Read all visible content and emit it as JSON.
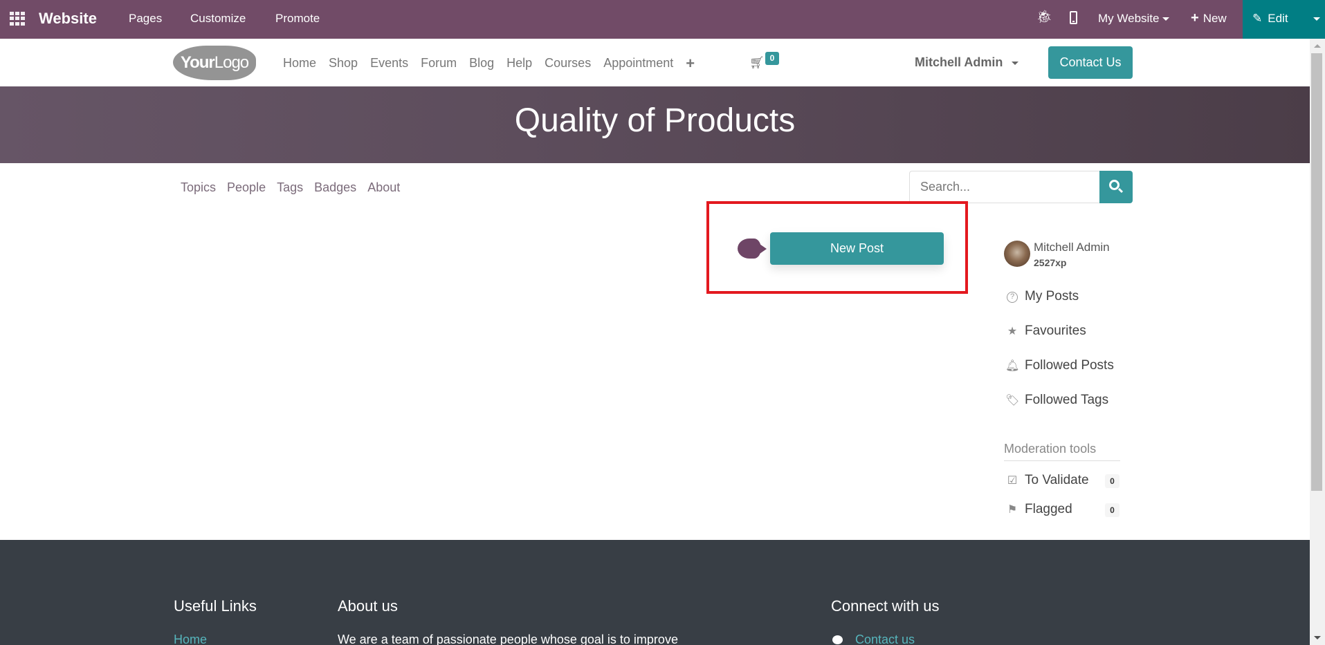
{
  "topbar": {
    "app_name": "Website",
    "menus": [
      "Pages",
      "Customize",
      "Promote"
    ],
    "website_selector": "My Website",
    "new_label": "New",
    "edit_label": "Edit",
    "icons": {
      "apps": "apps-grid-icon",
      "debug": "bug-icon",
      "mobile": "mobile-phone-icon",
      "new": "plus-icon",
      "edit": "pencil-icon"
    }
  },
  "header": {
    "logo": {
      "bold": "Your",
      "light": "Logo"
    },
    "nav": [
      "Home",
      "Shop",
      "Events",
      "Forum",
      "Blog",
      "Help",
      "Courses",
      "Appointment"
    ],
    "cart_count": "0",
    "user": "Mitchell Admin",
    "contact_label": "Contact Us"
  },
  "banner": {
    "title": "Quality of Products"
  },
  "forum_nav": {
    "items": [
      "Topics",
      "People",
      "Tags",
      "Badges",
      "About"
    ],
    "search_placeholder": "Search..."
  },
  "main": {
    "new_post_label": "New Post"
  },
  "sidebar": {
    "user_name": "Mitchell Admin",
    "user_xp": "2527xp",
    "links": [
      {
        "label": "My Posts",
        "icon": "question-circle-icon"
      },
      {
        "label": "Favourites",
        "icon": "star-icon"
      },
      {
        "label": "Followed Posts",
        "icon": "bell-icon"
      },
      {
        "label": "Followed Tags",
        "icon": "tags-icon"
      }
    ],
    "moderation_title": "Moderation tools",
    "moderation": [
      {
        "label": "To Validate",
        "count": "0",
        "icon": "check-square-icon"
      },
      {
        "label": "Flagged",
        "count": "0",
        "icon": "flag-icon"
      }
    ]
  },
  "footer": {
    "useful_links_title": "Useful Links",
    "useful_links": [
      "Home"
    ],
    "about_title": "About us",
    "about_text": "We are a team of passionate people whose goal is to improve",
    "connect_title": "Connect with us",
    "connect_links": [
      "Contact us"
    ]
  },
  "colors": {
    "topbar": "#714b67",
    "edit_bg": "#017e84",
    "primary": "#35979c",
    "highlight": "#e3191f",
    "footer_bg": "#383e45",
    "footer_link": "#56b5bc"
  }
}
